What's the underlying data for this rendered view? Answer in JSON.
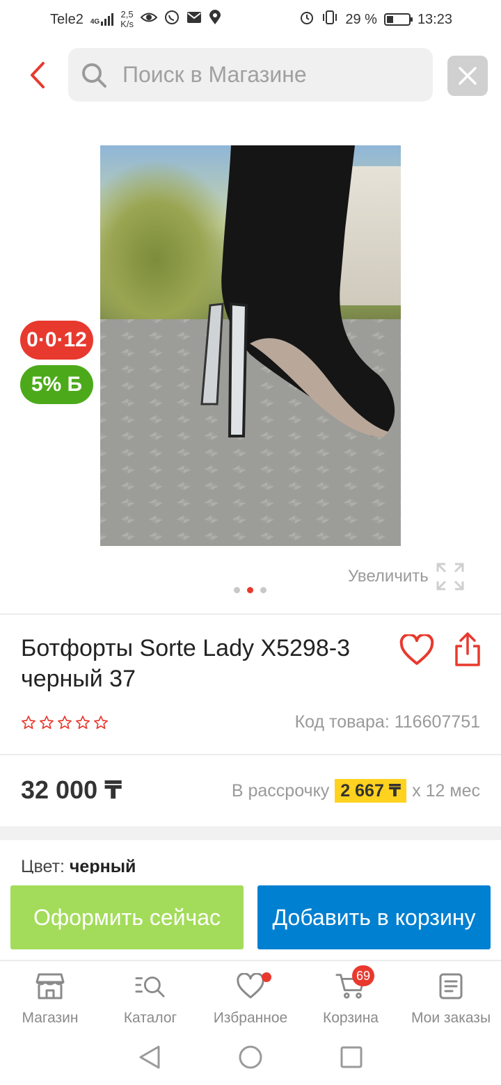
{
  "status_bar": {
    "carrier": "Tele2",
    "network": "4G",
    "speed_value": "2,5",
    "speed_unit": "K/s",
    "battery_percent": "29 %",
    "battery_level": 0.29,
    "time": "13:23"
  },
  "search": {
    "placeholder": "Поиск в Магазине",
    "value": ""
  },
  "badges": {
    "installment": "0·0·12",
    "bonus": "5% Б"
  },
  "gallery": {
    "zoom_label": "Увеличить",
    "total_images": 3,
    "active_index": 1
  },
  "product": {
    "title": "Ботфорты Sorte Lady X5298-3 черный 37",
    "rating": 0,
    "rating_max": 5,
    "sku_label": "Код товара: 116607751",
    "price": "32 000 ₸",
    "installment_prefix": "В рассрочку",
    "installment_amount": "2 667 ₸",
    "installment_suffix": "х 12 мес",
    "color_label": "Цвет:",
    "color_value": "черный"
  },
  "actions": {
    "checkout": "Оформить сейчас",
    "add_to_cart": "Добавить в корзину"
  },
  "tabs": [
    {
      "label": "Магазин",
      "icon": "store-icon"
    },
    {
      "label": "Каталог",
      "icon": "catalog-search-icon"
    },
    {
      "label": "Избранное",
      "icon": "heart-icon",
      "has_dot": true
    },
    {
      "label": "Корзина",
      "icon": "cart-icon",
      "badge": "69"
    },
    {
      "label": "Мои заказы",
      "icon": "orders-icon"
    }
  ],
  "colors": {
    "accent_red": "#e8392e",
    "bonus_green": "#4caa1a",
    "checkout_green": "#a3dc5a",
    "cart_blue": "#0080d0",
    "installment_yellow": "#ffd21f"
  }
}
